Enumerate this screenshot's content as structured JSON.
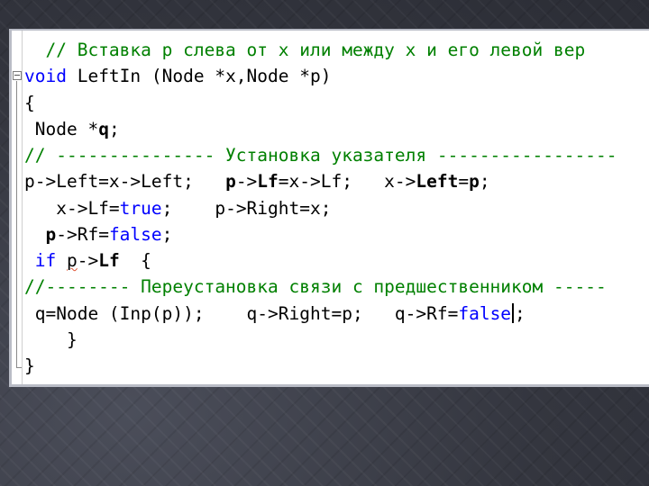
{
  "code_lines": [
    {
      "segments": [
        {
          "t": "  // Вставка р слева от x или между x и его левой вер",
          "cls": "c"
        }
      ]
    },
    {
      "segments": [
        {
          "t": "void",
          "cls": "k"
        },
        {
          "t": " LeftIn (Node *x,Node *p)",
          "cls": ""
        }
      ]
    },
    {
      "segments": [
        {
          "t": "{",
          "cls": ""
        }
      ]
    },
    {
      "segments": [
        {
          "t": " Node *",
          "cls": ""
        },
        {
          "t": "q",
          "cls": "b"
        },
        {
          "t": ";",
          "cls": ""
        }
      ]
    },
    {
      "segments": [
        {
          "t": "// --------------- Установка указателя -----------------",
          "cls": "c"
        }
      ]
    },
    {
      "segments": [
        {
          "t": "p->Left=x->Left;   ",
          "cls": ""
        },
        {
          "t": "p",
          "cls": "b"
        },
        {
          "t": "->",
          "cls": ""
        },
        {
          "t": "Lf",
          "cls": "b"
        },
        {
          "t": "=x->Lf;   x->",
          "cls": ""
        },
        {
          "t": "Left",
          "cls": "b"
        },
        {
          "t": "=",
          "cls": ""
        },
        {
          "t": "p",
          "cls": "b"
        },
        {
          "t": ";",
          "cls": ""
        }
      ]
    },
    {
      "segments": [
        {
          "t": "   x->Lf=",
          "cls": ""
        },
        {
          "t": "true",
          "cls": "k"
        },
        {
          "t": ";    p->Right=x;",
          "cls": ""
        }
      ]
    },
    {
      "segments": [
        {
          "t": "  ",
          "cls": ""
        },
        {
          "t": "p",
          "cls": "b"
        },
        {
          "t": "->Rf=",
          "cls": ""
        },
        {
          "t": "false",
          "cls": "k"
        },
        {
          "t": ";",
          "cls": ""
        }
      ]
    },
    {
      "segments": [
        {
          "t": " ",
          "cls": ""
        },
        {
          "t": "if",
          "cls": "k"
        },
        {
          "t": " ",
          "cls": ""
        },
        {
          "t": "p",
          "cls": "sq"
        },
        {
          "t": "->",
          "cls": ""
        },
        {
          "t": "Lf",
          "cls": "b"
        },
        {
          "t": "  {",
          "cls": ""
        }
      ]
    },
    {
      "segments": [
        {
          "t": "//-------- Переустановка связи с предшественником -----",
          "cls": "c"
        }
      ]
    },
    {
      "segments": [
        {
          "t": " q=Node (Inp(p));    q->Right=p;   q->Rf=",
          "cls": ""
        },
        {
          "t": "false",
          "cls": "k"
        },
        {
          "t": "",
          "cls": "caret"
        },
        {
          "t": ";",
          "cls": ""
        }
      ]
    },
    {
      "segments": [
        {
          "t": "    }",
          "cls": ""
        }
      ]
    },
    {
      "segments": [
        {
          "t": "}",
          "cls": ""
        }
      ]
    }
  ]
}
